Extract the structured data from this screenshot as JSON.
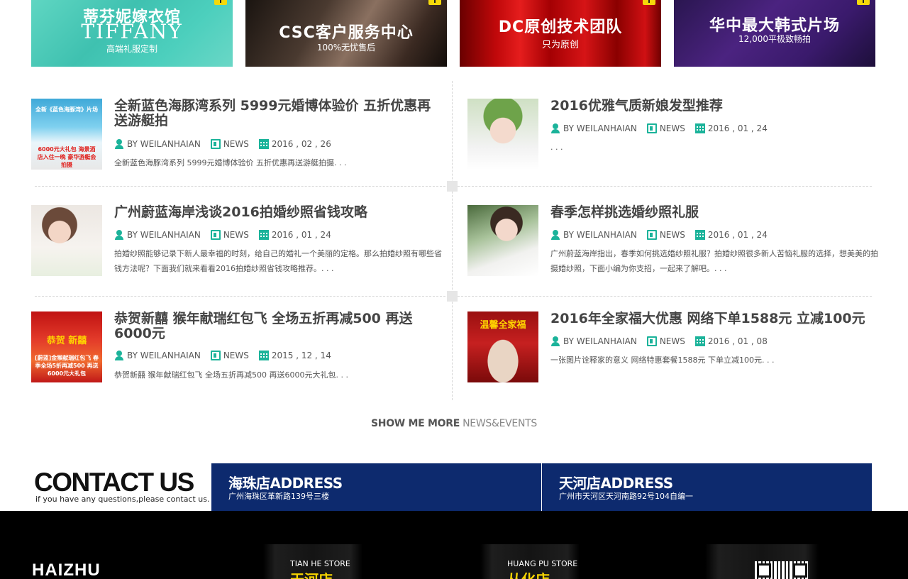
{
  "banners": [
    {
      "title": "蒂芬妮嫁衣馆",
      "title_en": "TIFFANY",
      "subtitle": "高端礼服定制"
    },
    {
      "title": "CSC客户服务中心",
      "subtitle": "100%无忧售后"
    },
    {
      "title": "DC原创技术团队",
      "subtitle": "只为原创"
    },
    {
      "title": "华中最大韩式片场",
      "subtitle": "12,000平极致畅拍"
    }
  ],
  "news": {
    "items": [
      {
        "title": "全新蓝色海豚湾系列 5999元婚博体验价 五折优惠再送游艇拍",
        "author": "BY WEILANHAIAN",
        "category": "NEWS",
        "date": "2016 , 02 , 26",
        "excerpt": "全新蓝色海豚湾系列  5999元婚博体验价  五折优惠再送游艇拍摄. . .",
        "thumb_top": "全新《蓝色海豚湾》片场",
        "thumb_bottom": "6000元大礼包 海景酒店入住一晚 豪华游艇会拍摄"
      },
      {
        "title": "2016优雅气质新娘发型推荐",
        "author": "BY WEILANHAIAN",
        "category": "NEWS",
        "date": "2016 , 01 , 24",
        "excerpt": ". . ."
      },
      {
        "title": "广州蔚蓝海岸浅谈2016拍婚纱照省钱攻略",
        "author": "BY WEILANHAIAN",
        "category": "NEWS",
        "date": "2016 , 01 , 24",
        "excerpt": "拍婚纱照能够记录下新人最幸福的时刻，给自己的婚礼一个美丽的定格。那么拍婚纱照有哪些省钱方法呢？下面我们就来看看2016拍婚纱照省钱攻略推荐。. . ."
      },
      {
        "title": "春季怎样挑选婚纱照礼服",
        "author": "BY WEILANHAIAN",
        "category": "NEWS",
        "date": "2016 , 01 , 24",
        "excerpt": "广州蔚蓝海岸指出，春季如何挑选婚纱照礼服？拍婚纱照很多新人苦恼礼服的选择，想美美的拍摄婚纱照，下面小编为你支招，一起来了解吧。. . ."
      },
      {
        "title": "恭贺新囍 猴年献瑞红包飞 全场五折再减500 再送6000元",
        "author": "BY WEILANHAIAN",
        "category": "NEWS",
        "date": "2015 , 12 , 14",
        "excerpt": "恭贺新囍  猴年献瑞红包飞  全场五折再减500  再送6000元大礼包. . .",
        "thumb_top": "恭贺 新囍",
        "thumb_bottom": "[蔚蓝]金猴献瑞红包飞 春季全场5折再减500 再送6000元大礼包"
      },
      {
        "title": "2016年全家福大优惠 网络下单1588元 立减100元",
        "author": "BY WEILANHAIAN",
        "category": "NEWS",
        "date": "2016 , 01 , 08",
        "excerpt": "一张图片诠释家的意义  网络特惠套餐1588元  下单立减100元. . .",
        "thumb_top": "温馨全家福"
      }
    ],
    "more_bold": "SHOW ME MORE",
    "more_light": "NEWS&EVENTS"
  },
  "contact": {
    "title": "CONTACT US",
    "subtitle": "if you have any questions,please contact us.",
    "addresses": [
      {
        "heading": "海珠店ADDRESS",
        "detail": "广州海珠区革新路139号三楼"
      },
      {
        "heading": "天河店ADDRESS",
        "detail": "广州市天河区天河南路92号104自编一"
      }
    ]
  },
  "footer": {
    "logo": "HAIZHU",
    "stores": [
      {
        "en": "TIAN HE STORE",
        "cn": "天河店"
      },
      {
        "en": "HUANG PU STORE",
        "cn": "从化店"
      }
    ]
  },
  "colors": {
    "accent": "#1bb39a",
    "navy": "#0d2a6e",
    "gold": "#f5d300"
  }
}
